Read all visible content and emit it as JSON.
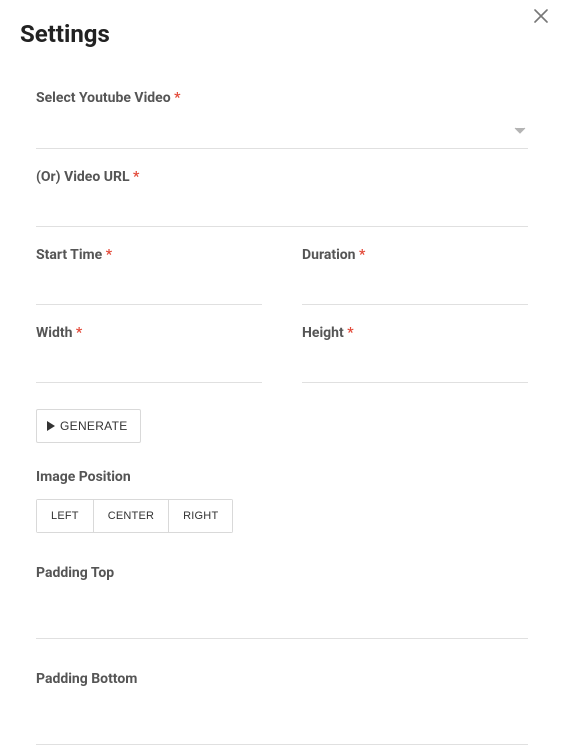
{
  "header": {
    "title": "Settings"
  },
  "actions": {
    "close_aria": "close"
  },
  "fields": {
    "select_video": {
      "label": "Select Youtube Video",
      "required": true
    },
    "video_url": {
      "label": "(Or) Video URL",
      "required": true,
      "value": ""
    },
    "start_time": {
      "label": "Start Time",
      "required": true,
      "value": ""
    },
    "duration": {
      "label": "Duration",
      "required": true,
      "value": ""
    },
    "width": {
      "label": "Width",
      "required": true,
      "value": ""
    },
    "height": {
      "label": "Height",
      "required": true,
      "value": ""
    },
    "padding_top": {
      "label": "Padding Top",
      "value": ""
    },
    "padding_bottom": {
      "label": "Padding Bottom",
      "value": ""
    }
  },
  "image_position": {
    "label": "Image Position",
    "options": {
      "left": "LEFT",
      "center": "CENTER",
      "right": "RIGHT"
    }
  },
  "buttons": {
    "generate": "GENERATE"
  },
  "required_marker": "*"
}
